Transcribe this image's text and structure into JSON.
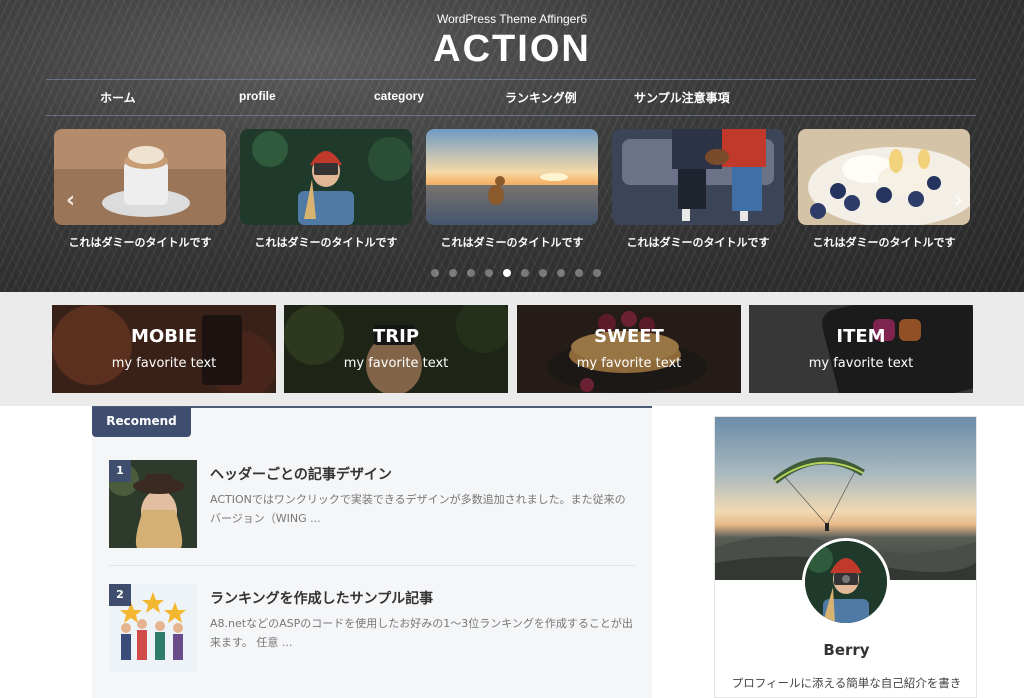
{
  "header": {
    "tagline": "WordPress Theme Affinger6",
    "logo": "ACTION"
  },
  "nav": {
    "items": [
      {
        "label": "ホーム"
      },
      {
        "label": "profile"
      },
      {
        "label": "category"
      },
      {
        "label": "ランキング例"
      },
      {
        "label": "サンプル注意事項"
      }
    ]
  },
  "slider": {
    "slides": [
      {
        "caption": "これはダミーのタイトルです",
        "image": "coffee-cup-photo"
      },
      {
        "caption": "これはダミーのタイトルです",
        "image": "camera-woman-photo"
      },
      {
        "caption": "これはダミーのタイトルです",
        "image": "beach-dog-sunset-photo"
      },
      {
        "caption": "これはダミーのタイトルです",
        "image": "couple-sofa-dog-photo"
      },
      {
        "caption": "これはダミーのタイトルです",
        "image": "pancake-blueberry-photo"
      }
    ],
    "dot_count": 10,
    "active_dot": 5
  },
  "categories": [
    {
      "title": "MOBIE",
      "subtitle": "my favorite text"
    },
    {
      "title": "TRIP",
      "subtitle": "my favorite text"
    },
    {
      "title": "SWEET",
      "subtitle": "my favorite text"
    },
    {
      "title": "ITEM",
      "subtitle": "my favorite text"
    }
  ],
  "recommend": {
    "tab_label": "Recomend",
    "items": [
      {
        "rank": "1",
        "title": "ヘッダーごとの記事デザイン",
        "excerpt": "ACTIONではワンクリックで実装できるデザインが多数追加されました。また従来のバージョン（WING ..."
      },
      {
        "rank": "2",
        "title": "ランキングを作成したサンプル記事",
        "excerpt": "A8.netなどのASPのコードを使用したお好みの1～3位ランキングを作成することが出来ます。 任意 ..."
      }
    ]
  },
  "profile": {
    "name": "Berry",
    "bio": "プロフィールに添える簡単な自己紹介を書き"
  },
  "colors": {
    "accent": "#3f4d6e",
    "band_bg": "#ebebeb",
    "recommend_bg": "#f5f6f8"
  }
}
